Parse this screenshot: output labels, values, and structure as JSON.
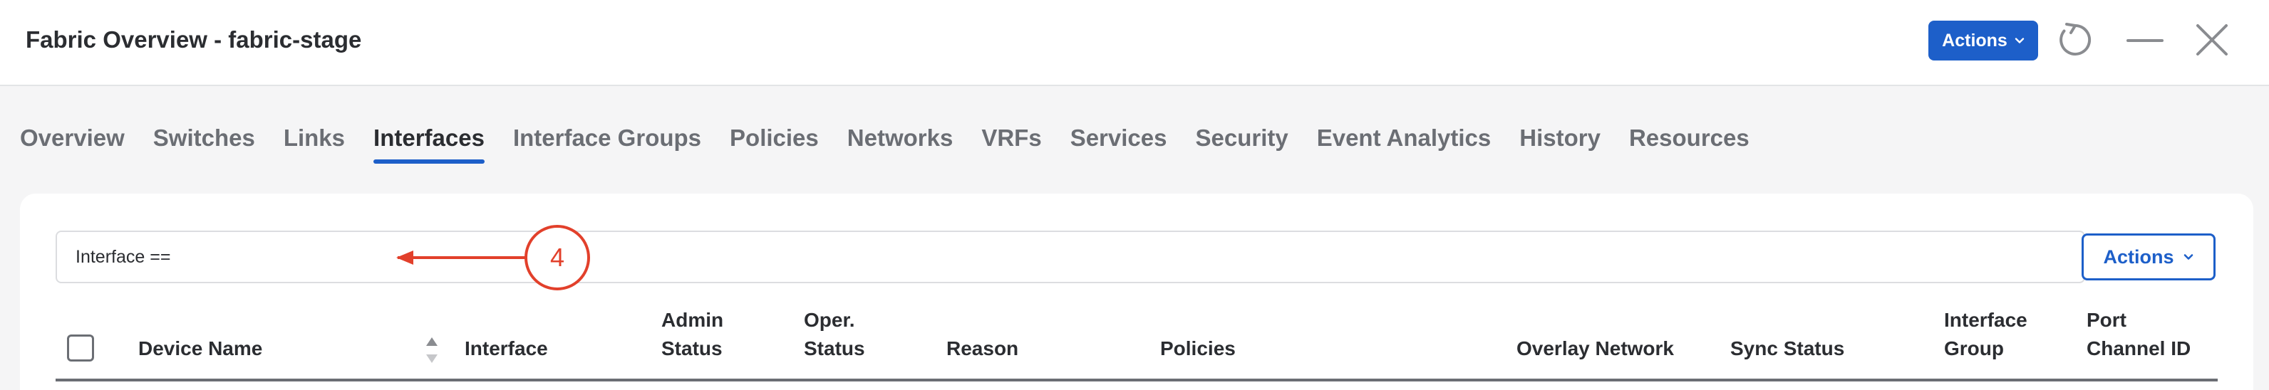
{
  "header": {
    "title": "Fabric Overview - fabric-stage",
    "actions_label": "Actions",
    "icons": [
      "refresh-icon",
      "minimize-icon",
      "close-icon"
    ]
  },
  "tabs": [
    {
      "label": "Overview",
      "active": false
    },
    {
      "label": "Switches",
      "active": false
    },
    {
      "label": "Links",
      "active": false
    },
    {
      "label": "Interfaces",
      "active": true
    },
    {
      "label": "Interface Groups",
      "active": false
    },
    {
      "label": "Policies",
      "active": false
    },
    {
      "label": "Networks",
      "active": false
    },
    {
      "label": "VRFs",
      "active": false
    },
    {
      "label": "Services",
      "active": false
    },
    {
      "label": "Security",
      "active": false
    },
    {
      "label": "Event Analytics",
      "active": false
    },
    {
      "label": "History",
      "active": false
    },
    {
      "label": "Resources",
      "active": false
    }
  ],
  "filter": {
    "value": "Interface =="
  },
  "annotation": {
    "number": "4"
  },
  "card": {
    "actions_label": "Actions"
  },
  "table": {
    "columns": [
      {
        "line1": "Device Name",
        "line2": ""
      },
      {
        "line1": "Interface",
        "line2": ""
      },
      {
        "line1": "Admin",
        "line2": "Status"
      },
      {
        "line1": "Oper.",
        "line2": "Status"
      },
      {
        "line1": "Reason",
        "line2": ""
      },
      {
        "line1": "Policies",
        "line2": ""
      },
      {
        "line1": "Overlay Network",
        "line2": ""
      },
      {
        "line1": "Sync Status",
        "line2": ""
      },
      {
        "line1": "Interface",
        "line2": "Group"
      },
      {
        "line1": "Port",
        "line2": "Channel ID"
      }
    ]
  },
  "colors": {
    "primary": "#1d5fc9",
    "annotation": "#e2402b",
    "text": "#2b2d31",
    "muted": "#6b6e74"
  }
}
